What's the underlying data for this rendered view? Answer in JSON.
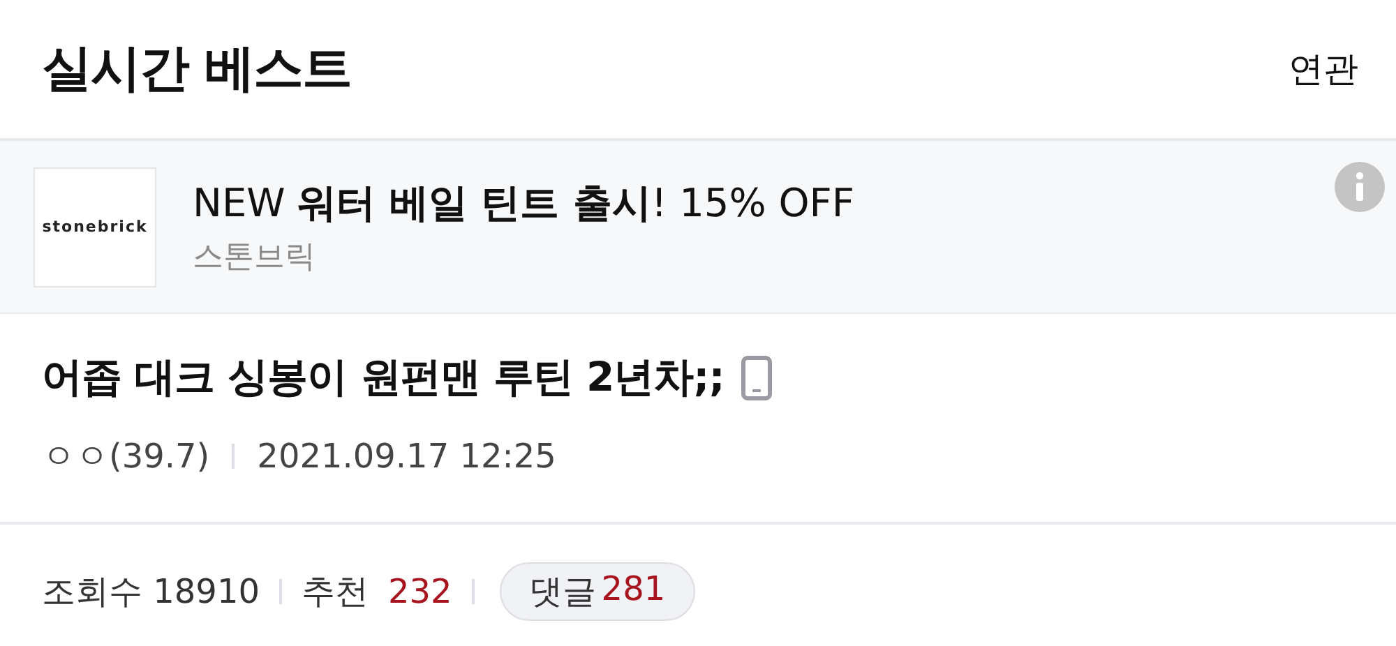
{
  "header": {
    "title": "실시간 베스트",
    "related_link": "연관"
  },
  "ad": {
    "logo_text": "stonebrick",
    "headline": "NEW **워터 베일 틴트 출시**! 15% OFF",
    "advertiser": "스톤브릭"
  },
  "post": {
    "title": "어좁 대크 싱봉이 원펀맨 루틴 2년차;;",
    "author": "ㅇㅇ(39.7)",
    "date": "2021.09.17 12:25"
  },
  "stats": {
    "views_label": "조회수",
    "views": "18910",
    "recommend_label": "추천",
    "recommend": "232",
    "comments_label": "댓글",
    "comments": "281"
  }
}
